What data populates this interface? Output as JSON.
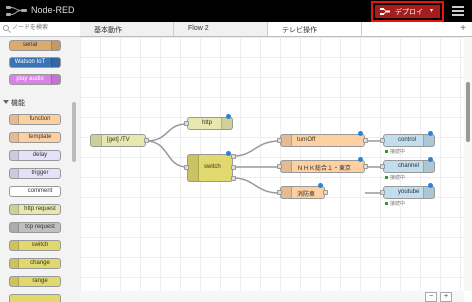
{
  "header": {
    "app_title": "Node-RED",
    "deploy_label": "デプロイ",
    "deploy_caret": "▾",
    "colors": {
      "bar": "#000000",
      "deploy": "#a51d1d",
      "highlight": "#ee1111"
    }
  },
  "palette": {
    "search_placeholder": "ノードを検索",
    "top_nodes": [
      {
        "label": "serial",
        "color": "#dbaa6f"
      },
      {
        "label": "Watson IoT",
        "color": "#3b74b4"
      },
      {
        "label": "play audio",
        "color": "#d982e6"
      }
    ],
    "category": "機能",
    "function_nodes": [
      {
        "label": "function",
        "color": "#fdd0a2"
      },
      {
        "label": "template",
        "color": "#fdd0a2"
      },
      {
        "label": "delay",
        "color": "#e6e0f8"
      },
      {
        "label": "trigger",
        "color": "#e6e0f8"
      },
      {
        "label": "comment",
        "color": "#ffffff"
      },
      {
        "label": "http request",
        "color": "#e7e7ae"
      },
      {
        "label": "tcp request",
        "color": "#c0c0c0"
      },
      {
        "label": "switch",
        "color": "#e2d96e"
      },
      {
        "label": "change",
        "color": "#e2d96e"
      },
      {
        "label": "range",
        "color": "#e2d96e"
      }
    ]
  },
  "tabs": [
    {
      "label": "基本動作"
    },
    {
      "label": "Flow 2"
    },
    {
      "label": "テレビ操作"
    }
  ],
  "tab_add": "+",
  "flow": {
    "nodes": {
      "inject": {
        "label": "[get] /TV"
      },
      "http": {
        "label": "http"
      },
      "switch": {
        "label": "switch"
      },
      "f1": {
        "label": "turnOff"
      },
      "f2": {
        "label": "ＮＨＫ総合１・東京"
      },
      "f3": {
        "label": "消防車"
      },
      "control": {
        "label": "control",
        "status": "接続中"
      },
      "channel": {
        "label": "channel",
        "status": "接続中"
      },
      "youtube": {
        "label": "youtube",
        "status": "接続中"
      }
    }
  },
  "zoom": {
    "minus": "−",
    "plus": "+"
  }
}
